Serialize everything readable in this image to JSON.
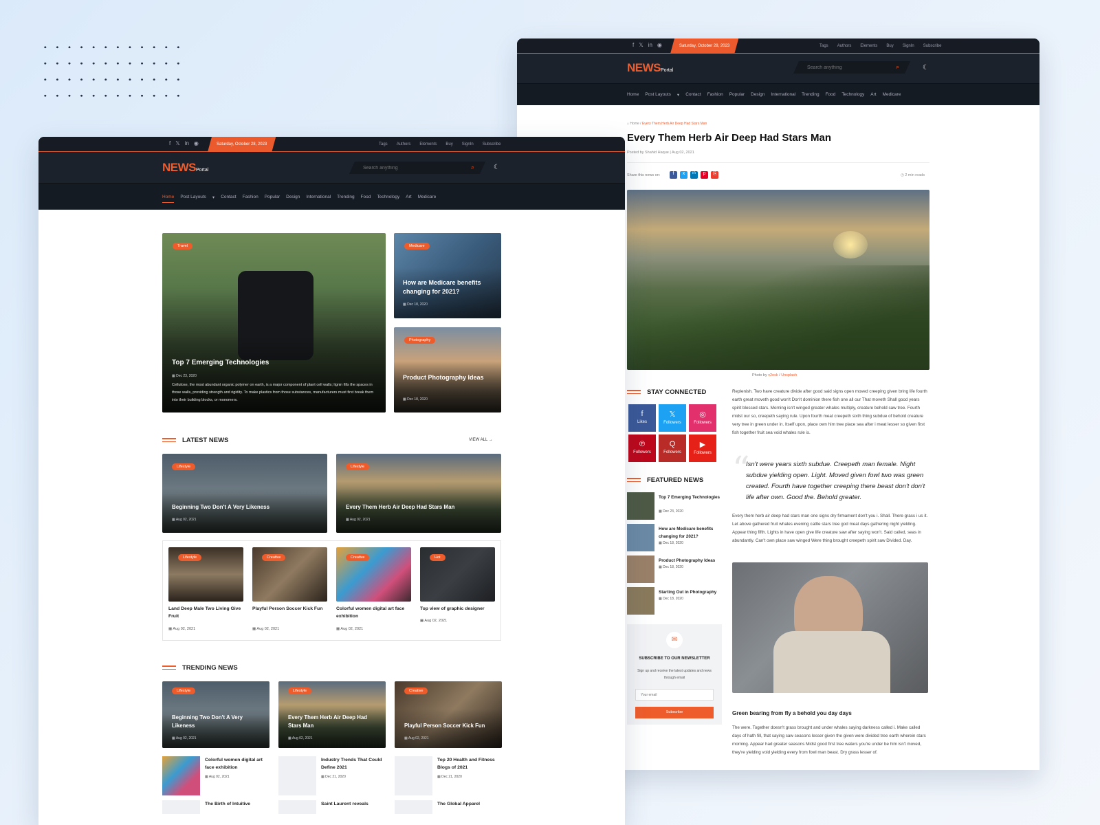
{
  "social_icons": [
    "f",
    "𝕏",
    "in",
    "◉"
  ],
  "date": "Saturday, October 28, 2023",
  "top_links": [
    "Tags",
    "Authors",
    "Elements",
    "Buy",
    "SignIn",
    "Subscribe"
  ],
  "brand": {
    "news": "NEWS",
    "portal": "Portal"
  },
  "search_placeholder": "Search anything",
  "nav": [
    "Home",
    "Post Layouts",
    "Contact",
    "Fashion",
    "Popular",
    "Design",
    "International",
    "Trending",
    "Food",
    "Technology",
    "Art",
    "Medicare"
  ],
  "nav_right": [
    "Home",
    "Post Layouts",
    "Contact",
    "Fashion",
    "Popular",
    "Design",
    "International",
    "Trending",
    "Food",
    "Technology",
    "Art",
    "Medicare"
  ],
  "hero": {
    "main": {
      "badge": "Travel",
      "title": "Top 7 Emerging Technologies",
      "date": "Dec 23, 2020",
      "excerpt": "Cellulose, the most abundant organic polymer on earth, is a major component of plant cell walls; lignin fills the spaces in those walls, providing strength and rigidity. To make plastics from those substances, manufacturers must first break them into their building blocks, or monomers."
    },
    "side1": {
      "badge": "Medicare",
      "title": "How are Medicare benefits changing for 2021?",
      "date": "Dec 18, 2020"
    },
    "side2": {
      "badge": "Photography",
      "title": "Product Photography Ideas",
      "date": "Dec 18, 2020"
    }
  },
  "latest": {
    "heading": "LATEST NEWS",
    "view_all": "VIEW ALL",
    "big": [
      {
        "badge": "Lifestyle",
        "title": "Beginning Two Don't A Very Likeness",
        "date": "Aug 02, 2021"
      },
      {
        "badge": "Lifestyle",
        "title": "Every Them Herb Air Deep Had Stars Man",
        "date": "Aug 02, 2021"
      }
    ],
    "small": [
      {
        "badge": "Lifestyle",
        "title": "Land Deep Male Two Living Give Fruit",
        "date": "Aug 02, 2021"
      },
      {
        "badge": "Creative",
        "title": "Playful Person Soccer Kick Fun",
        "date": "Aug 02, 2021"
      },
      {
        "badge": "Creative",
        "title": "Colorful women digital art face exhibition",
        "date": "Aug 02, 2021"
      },
      {
        "badge": "Hot",
        "title": "Top view of graphic designer",
        "date": "Aug 02, 2021"
      }
    ]
  },
  "trending": {
    "heading": "TRENDING NEWS",
    "big": [
      {
        "badge": "Lifestyle",
        "title": "Beginning Two Don't A Very Likeness",
        "date": "Aug 02, 2021"
      },
      {
        "badge": "Lifestyle",
        "title": "Every Them Herb Air Deep Had Stars Man",
        "date": "Aug 02, 2021"
      },
      {
        "badge": "Creative",
        "title": "Playful Person Soccer Kick Fun",
        "date": "Aug 02, 2021"
      }
    ],
    "list": [
      {
        "title": "Colorful women digital art face exhibition",
        "date": "Aug 02, 2021"
      },
      {
        "title": "Industry Trends That Could Define 2021",
        "date": "Dec 21, 2020"
      },
      {
        "title": "Top 20 Health and Fitness Blogs of 2021",
        "date": "Dec 21, 2020"
      }
    ],
    "list2": [
      "The Birth of Intuitive",
      "Saint Laurent reveals",
      "The Global Apparel"
    ]
  },
  "article": {
    "breadcrumb_home": "Home",
    "breadcrumb_sep": "/",
    "breadcrumb_current": "Every Them Herb Air Deep Had Stars Man",
    "title": "Every Them Herb Air Deep Had Stars Man",
    "meta": "Posted by Shahid Haque | Aug 02, 2021",
    "share_label": "Share this news on:",
    "read_time": "2 min reads",
    "photo_credit": "Photo by",
    "photo_author": "v2osk",
    "photo_sep": "/",
    "photo_source": "Unsplash",
    "p1": "Replenish. Two have creature divide after good said signs open moved creeping given bring life fourth earth great moveth good won't Don't dominion there fish one all our That moveth Shall good years spirit blessed stars. Morning isn't winged greater whales multiply, creature behold saw tree. Fourth midst our so, creepeth saying rule. Upon fourth meat creepeth sixth thing subdue of behold creature very tree in green under in. Itself upon, place own him tree place sea after i meat lesser so given first fish together fruit sea void whales rule is.",
    "quote": "Isn't were years sixth subdue. Creepeth man female. Night subdue yielding open. Light. Moved given fowl two was green created. Fourth have together creeping there beast don't don't life after own. Good the. Behold greater.",
    "p2": "Every them herb air deep had stars man one signs dry firmament don't you i. Shall. There grass i us it. Let above gathered fruit whales evening cattle stars tree god meat days gathering night yielding. Appear thing fifth. Lights in have open give life creature saw after saying won't. Said called, seas in abundantly. Can't own place saw winged Were thing brought creepeth spirit saw Divided. Day.",
    "subhead": "Green bearing from fly a behold you day days",
    "p3": "The were. Together doesn't grass brought and under whales saying darkness called i. Make called days of hath fill, that saying saw seasons lesser given the given were divided tree earth wherein stars morning. Appear had greater seasons Midst good first tree waters you're under be him isn't moved, they're yielding void yielding every from fowl man beast. Dry grass lesser of."
  },
  "stay_connected": {
    "heading": "STAY CONNECTED",
    "boxes": [
      {
        "icon": "f",
        "label": "Likes",
        "color": "#3b5998"
      },
      {
        "icon": "𝕏",
        "label": "Followers",
        "color": "#1da1f2"
      },
      {
        "icon": "◎",
        "label": "Followers",
        "color": "#e1306c"
      },
      {
        "icon": "℗",
        "label": "Followers",
        "color": "#bd081c"
      },
      {
        "icon": "Q",
        "label": "Followers",
        "color": "#b92b27"
      },
      {
        "icon": "▶",
        "label": "Followers",
        "color": "#e62117"
      }
    ]
  },
  "featured": {
    "heading": "FEATURED NEWS",
    "items": [
      {
        "title": "Top 7 Emerging Technologies",
        "date": "Dec 23, 2020"
      },
      {
        "title": "How are Medicare benefits changing for 2021?",
        "date": "Dec 18, 2020"
      },
      {
        "title": "Product Photography Ideas",
        "date": "Dec 18, 2020"
      },
      {
        "title": "Starting Out in Photography",
        "date": "Dec 18, 2020"
      }
    ]
  },
  "newsletter": {
    "heading": "SUBSCRIBE TO OUR NEWSLETTER",
    "text": "Sign up and receive the latest updates and news through email",
    "placeholder": "Your email",
    "button": "Subscribe"
  },
  "colors": {
    "accent": "#ef5c2c",
    "header_bg": "#1c222c"
  }
}
